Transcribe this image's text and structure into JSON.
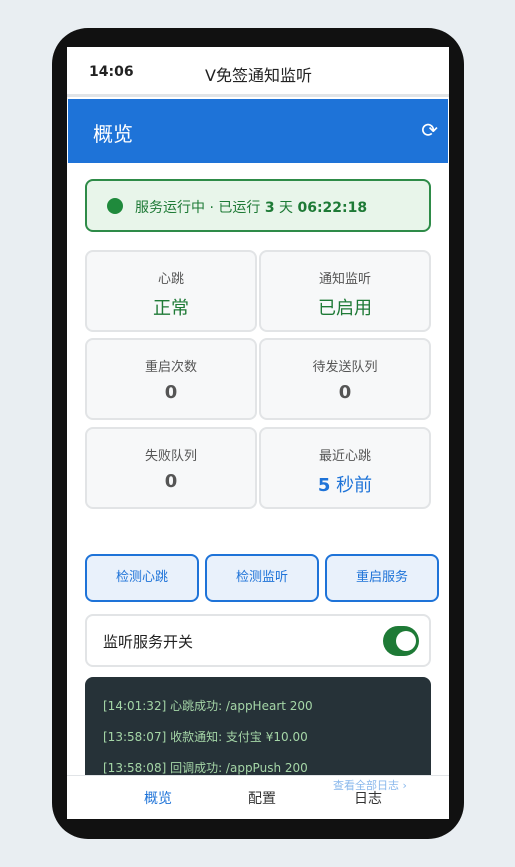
{
  "status_bar": {
    "time": "14:06",
    "title": "V免签通知监听"
  },
  "appbar": {
    "title": "概览",
    "refresh_icon": "⟳"
  },
  "status_banner": {
    "prefix": "服务运行中 · 已运行 ",
    "days": "3",
    "days_unit": " 天 ",
    "uptime": "06:22:18"
  },
  "cards": [
    {
      "label": "心跳",
      "value": "正常"
    },
    {
      "label": "通知监听",
      "value": "已启用"
    },
    {
      "label": "重启次数",
      "value": "0"
    },
    {
      "label": "待发送队列",
      "value": "0"
    },
    {
      "label": "失败队列",
      "value": "0"
    },
    {
      "label": "最近心跳",
      "value_num": "5",
      "value_unit": " 秒前"
    }
  ],
  "actions": {
    "check_heartbeat": "检测心跳",
    "check_listener": "检测监听",
    "restart_service": "重启服务"
  },
  "toggle": {
    "label": "监听服务开关",
    "on": true
  },
  "logs": [
    "[14:01:32] 心跳成功: /appHeart 200",
    "[13:58:07] 收款通知: 支付宝 ¥10.00",
    "[13:58:08] 回调成功: /appPush 200"
  ],
  "log_more": "查看全部日志 ›",
  "bottom_nav": [
    {
      "label": "概览",
      "active": true
    },
    {
      "label": "配置",
      "active": false
    },
    {
      "label": "日志",
      "active": false
    }
  ],
  "colors": {
    "primary": "#1e73d8",
    "success": "#1e7a36",
    "log_bg": "#263238"
  }
}
